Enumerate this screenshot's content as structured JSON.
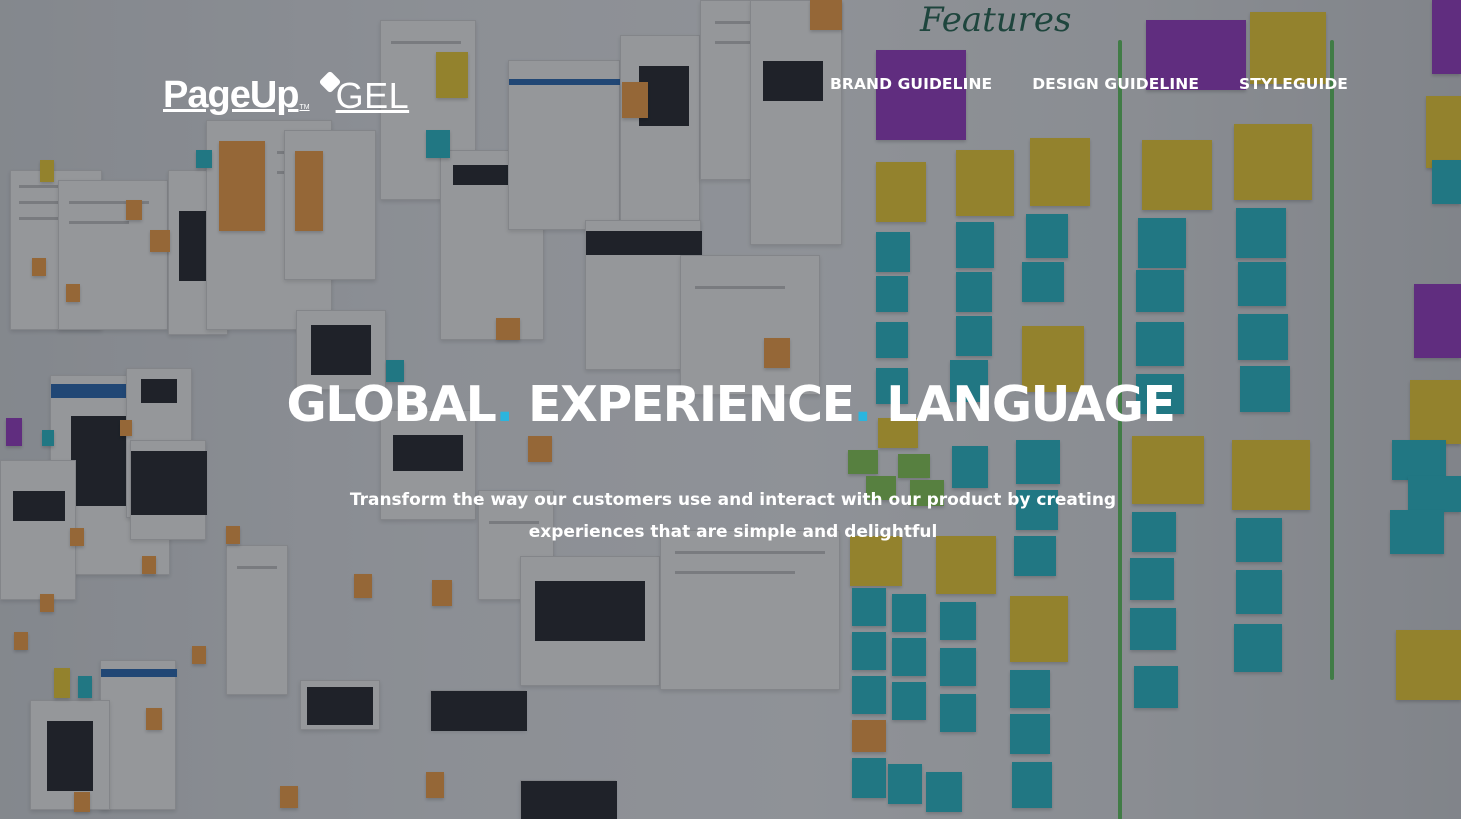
{
  "brand": {
    "name": "PageUp",
    "trademark": "TM",
    "suffix": "GEL",
    "logo_icon": "diamond-icon"
  },
  "nav": {
    "items": [
      {
        "label": "BRAND GUIDELINE"
      },
      {
        "label": "DESIGN GUIDELINE"
      },
      {
        "label": "STYLEGUIDE"
      }
    ]
  },
  "hero": {
    "headline": {
      "word1": "GLOBAL",
      "word2": "EXPERIENCE",
      "word3": "LANGUAGE",
      "separator": "."
    },
    "subtitle": "Transform the way our customers use and interact with our product by creating experiences that are simple and delightful",
    "wall_scrawl": "Features"
  },
  "colors": {
    "accent_dot": "#2bb5de",
    "text": "#ffffff",
    "overlay": "rgba(14, 20, 28, 0.42)",
    "sticky_yellow": "#f3d23a",
    "sticky_cyan": "#2fbfce",
    "sticky_orange": "#f6a44b",
    "sticky_purple": "#9b41c7"
  }
}
